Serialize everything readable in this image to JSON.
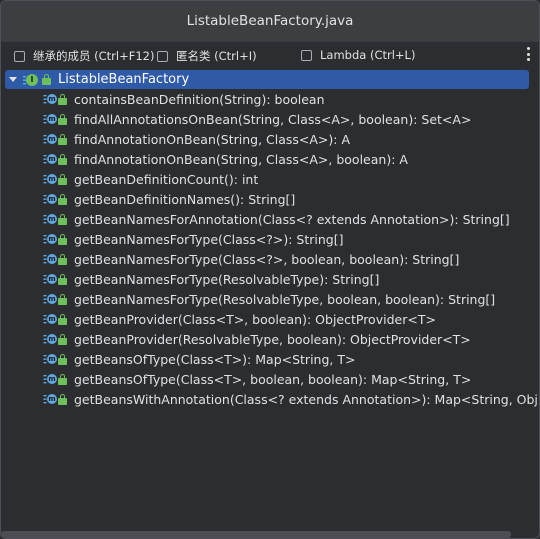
{
  "window": {
    "title": "ListableBeanFactory.java"
  },
  "options": {
    "inherited_label": "继承的成员 (Ctrl+F12)",
    "anonymous_label": "匿名类 (Ctrl+I)",
    "lambda_label": "Lambda (Ctrl+L)"
  },
  "tree": {
    "root_label": "ListableBeanFactory",
    "method_badge": "m",
    "interface_badge": "I",
    "items": [
      "containsBeanDefinition(String): boolean",
      "findAllAnnotationsOnBean(String, Class<A>, boolean): Set<A>",
      "findAnnotationOnBean(String, Class<A>): A",
      "findAnnotationOnBean(String, Class<A>, boolean): A",
      "getBeanDefinitionCount(): int",
      "getBeanDefinitionNames(): String[]",
      "getBeanNamesForAnnotation(Class<? extends Annotation>): String[]",
      "getBeanNamesForType(Class<?>): String[]",
      "getBeanNamesForType(Class<?>, boolean, boolean): String[]",
      "getBeanNamesForType(ResolvableType): String[]",
      "getBeanNamesForType(ResolvableType, boolean, boolean): String[]",
      "getBeanProvider(Class<T>, boolean): ObjectProvider<T>",
      "getBeanProvider(ResolvableType, boolean): ObjectProvider<T>",
      "getBeansOfType(Class<T>): Map<String, T>",
      "getBeansOfType(Class<T>, boolean, boolean): Map<String, T>",
      "getBeansWithAnnotation(Class<? extends Annotation>): Map<String, Obj"
    ]
  },
  "colors": {
    "selection": "#2e5aa8",
    "method_icon": "#5ea7df",
    "lock_icon": "#6ec05a",
    "background": "#2b2d30"
  }
}
